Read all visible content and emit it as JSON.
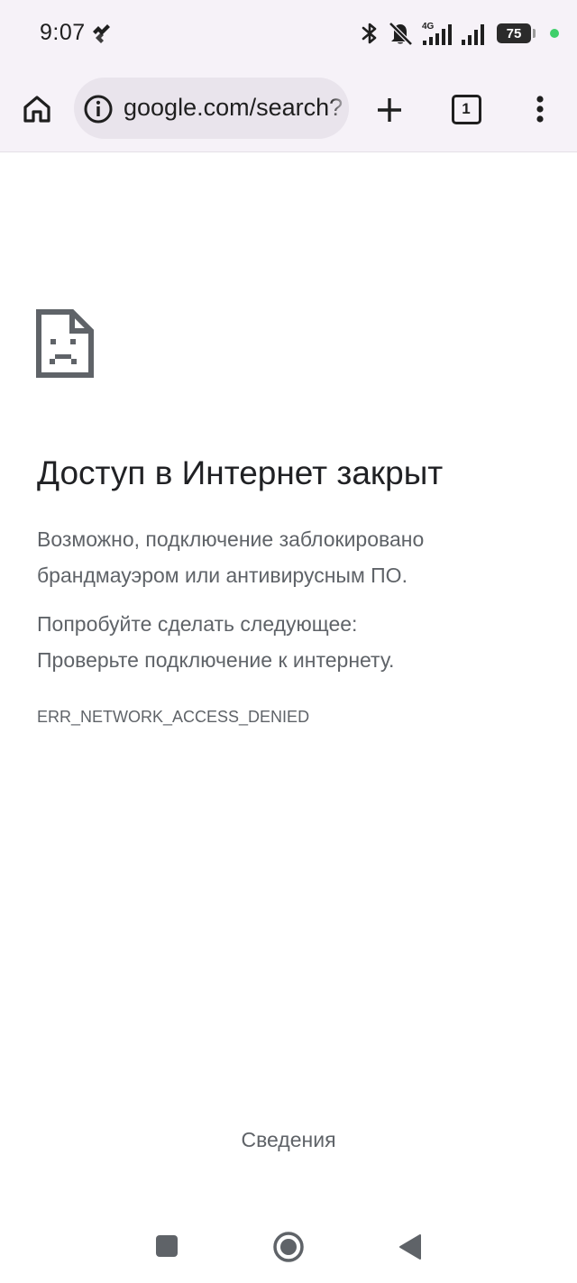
{
  "status_bar": {
    "time": "9:07",
    "network_label": "4G",
    "battery_level": "75",
    "icons": [
      "app-notification-icon",
      "bluetooth-icon",
      "notifications-muted-icon",
      "signal-4g-icon",
      "signal-icon",
      "battery-icon"
    ]
  },
  "toolbar": {
    "url": "google.com/search?",
    "tab_count": "1",
    "icons": [
      "home-icon",
      "info-icon",
      "plus-icon",
      "tab-switcher-icon",
      "more-vert-icon"
    ]
  },
  "error_page": {
    "icon": "sad-document-icon",
    "title": "Доступ в Интернет закрыт",
    "description": "Возможно, подключение заблокировано брандмауэром или антивирусным ПО.",
    "suggestions_heading": "Попробуйте сделать следующее:",
    "suggestion_item": "Проверьте подключение к интернету.",
    "error_code": "ERR_NETWORK_ACCESS_DENIED",
    "details_button": "Сведения"
  },
  "nav_bar": {
    "icons": [
      "recents-square-icon",
      "home-circle-icon",
      "back-triangle-icon"
    ]
  },
  "colors": {
    "toolbar_bg": "#f6f2f8",
    "omnibox_bg": "#e9e4ec",
    "title_text": "#202124",
    "secondary_text": "#5f6368",
    "privacy_dot": "#3ecf6a"
  }
}
